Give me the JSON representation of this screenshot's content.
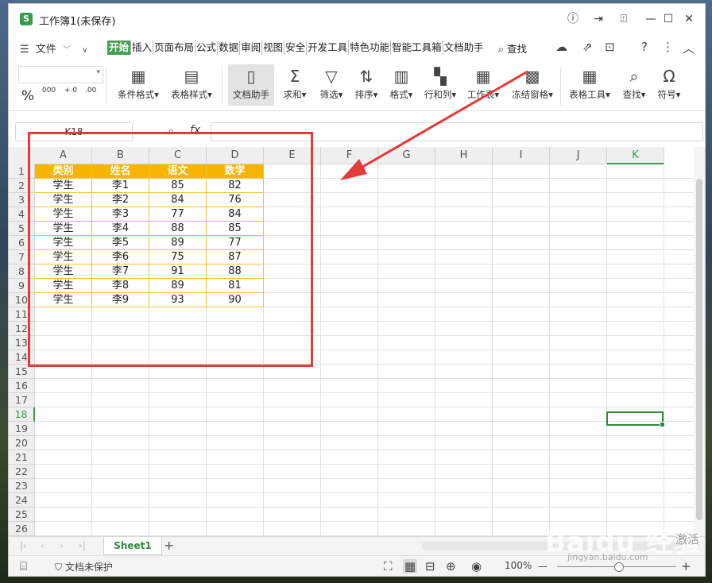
{
  "window": {
    "title": "工作簿1(未保存)"
  },
  "title_buttons": [
    "ⓘ",
    "⇥",
    "⍐",
    "—",
    "☐",
    "✕"
  ],
  "menu": {
    "file_label": "文件",
    "tabs": [
      "开始",
      "插入",
      "页面布局",
      "公式",
      "数据",
      "审阅",
      "视图",
      "安全",
      "开发工具",
      "特色功能",
      "智能工具箱",
      "文档助手"
    ],
    "active_tab": "开始",
    "search_label": "查找"
  },
  "ribbon": {
    "format_symbols": [
      "%",
      "000",
      "+.0",
      ".00"
    ],
    "buttons": [
      {
        "label": "条件格式",
        "icon": "conditional-format-icon",
        "glyph": "▦",
        "dropdown": true
      },
      {
        "label": "表格样式",
        "icon": "table-style-icon",
        "glyph": "▤",
        "dropdown": true
      },
      {
        "label": "文档助手",
        "icon": "document-assistant-icon",
        "glyph": "▯",
        "dropdown": false,
        "pressed": true
      },
      {
        "label": "求和",
        "icon": "sum-icon",
        "glyph": "Σ",
        "dropdown": true
      },
      {
        "label": "筛选",
        "icon": "filter-icon",
        "glyph": "▽",
        "dropdown": true
      },
      {
        "label": "排序",
        "icon": "sort-icon",
        "glyph": "⇅",
        "dropdown": true
      },
      {
        "label": "格式",
        "icon": "format-icon",
        "glyph": "▥",
        "dropdown": true
      },
      {
        "label": "行和列",
        "icon": "rows-columns-icon",
        "glyph": "▚",
        "dropdown": true
      },
      {
        "label": "工作表",
        "icon": "worksheet-icon",
        "glyph": "▦",
        "dropdown": true
      },
      {
        "label": "冻结窗格",
        "icon": "freeze-panes-icon",
        "glyph": "▩",
        "dropdown": true
      },
      {
        "label": "表格工具",
        "icon": "table-tools-icon",
        "glyph": "▦",
        "dropdown": true
      },
      {
        "label": "查找",
        "icon": "find-icon",
        "glyph": "⌕",
        "dropdown": true
      },
      {
        "label": "符号",
        "icon": "symbol-icon",
        "glyph": "Ω",
        "dropdown": true
      }
    ]
  },
  "formula_bar": {
    "name_box": "K18",
    "fx_label": "fx",
    "formula": ""
  },
  "columns": [
    "A",
    "B",
    "C",
    "D",
    "E",
    "F",
    "G",
    "H",
    "I",
    "J",
    "K"
  ],
  "selected_column": "K",
  "rows": [
    "1",
    "2",
    "3",
    "4",
    "5",
    "6",
    "7",
    "8",
    "9",
    "10",
    "11",
    "12",
    "13",
    "14",
    "15",
    "16",
    "17",
    "18",
    "19",
    "20",
    "21",
    "22",
    "23",
    "24",
    "25",
    "26"
  ],
  "selected_row": "18",
  "table": {
    "header": [
      "类别",
      "姓名",
      "语文",
      "数学"
    ],
    "rows": [
      [
        "学生",
        "李1",
        "85",
        "82"
      ],
      [
        "学生",
        "李2",
        "84",
        "76"
      ],
      [
        "学生",
        "李3",
        "77",
        "84"
      ],
      [
        "学生",
        "李4",
        "88",
        "85"
      ],
      [
        "学生",
        "李5",
        "89",
        "77"
      ],
      [
        "学生",
        "李6",
        "75",
        "87"
      ],
      [
        "学生",
        "李7",
        "91",
        "88"
      ],
      [
        "学生",
        "李8",
        "89",
        "81"
      ],
      [
        "学生",
        "李9",
        "93",
        "90"
      ]
    ],
    "header_color": "#F7B500"
  },
  "sheet_tabs": [
    "Sheet1"
  ],
  "status": {
    "protect_label": "文档未保护",
    "zoom": "100%"
  },
  "watermark": {
    "text": "Baidu 经验",
    "side_text": "激活",
    "sub_text": "jingyan.baidu.com"
  },
  "colors": {
    "accent": "#43A04F",
    "annotation": "#E53A3A"
  }
}
